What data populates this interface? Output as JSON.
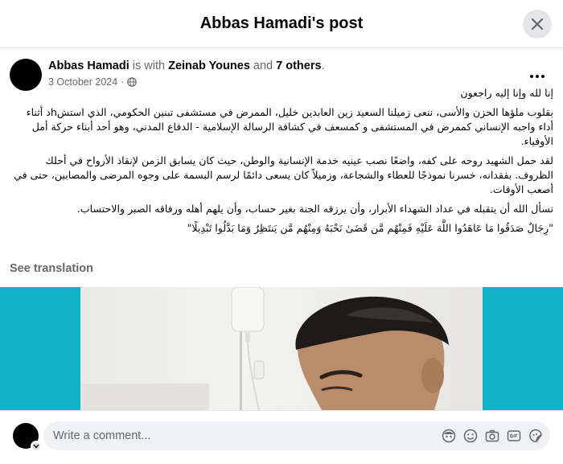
{
  "header": {
    "title": "Abbas Hamadi's post"
  },
  "post": {
    "author": "Abbas Hamadi",
    "with_text": "is with",
    "tagged": "Zeinab Younes",
    "and_text": "and",
    "others": "7 others",
    "period": ".",
    "date": "3 October 2024",
    "separator": "·",
    "audience_icon": "globe-icon",
    "paragraphs": [
      "إنا لله وإنا إليه راجعون",
      "بقلوب ملؤها الحزن والأسى، ننعى زميلنا  السعيد زين العابدين خليل، الممرض في مستشفى تبنين الحكومي، الذي استشhد أثناء أداء واجبه الإنساني كممرض في المستشفى و كمسعف في كشافة الرسالة الإسلامية - الدفاع المدني، وهو أحد أبناء حركة أمل الأوفياء.",
      "لقد حمل الشهيد روحه على كفه، واضعًا نصب عينيه خدمة الإنسانية والوطن، حيث كان يسابق الزمن لإنقاذ الأرواح في أحلك الظروف. بفقدانه، خسرنا نموذجًا للعطاء والشجاعة، وزميلاً كان يسعى دائمًا لرسم البسمة على وجوه المرضى والمصابين، حتى في أصعب الأوقات.",
      "نسأل الله أن يتقبله في عداد الشهداء الأبرار، وأن يرزقه الجنة بغير حساب، وأن يلهم أهله ورفاقه الصبر والاحتساب.",
      "\"رِجَالٌ صَدَقُوا مَا عَاهَدُوا اللَّهَ عَلَيْهِ فَمِنْهُم مَّن قَضَىٰ نَحْبَهُ وَمِنْهُم مَّن يَنتَظِرُ وَمَا بَدَّلُوا تَبْدِيلًا\""
    ],
    "see_translation": "See translation"
  },
  "footer": {
    "comment_placeholder": "Write a comment...",
    "icons": [
      "avatar-sticker-icon",
      "emoji-icon",
      "camera-icon",
      "gif-icon",
      "sticker-icon"
    ]
  },
  "colors": {
    "media_background": "#0fb2c7",
    "secondary_text": "#65676b",
    "divider": "#e4e6eb"
  }
}
